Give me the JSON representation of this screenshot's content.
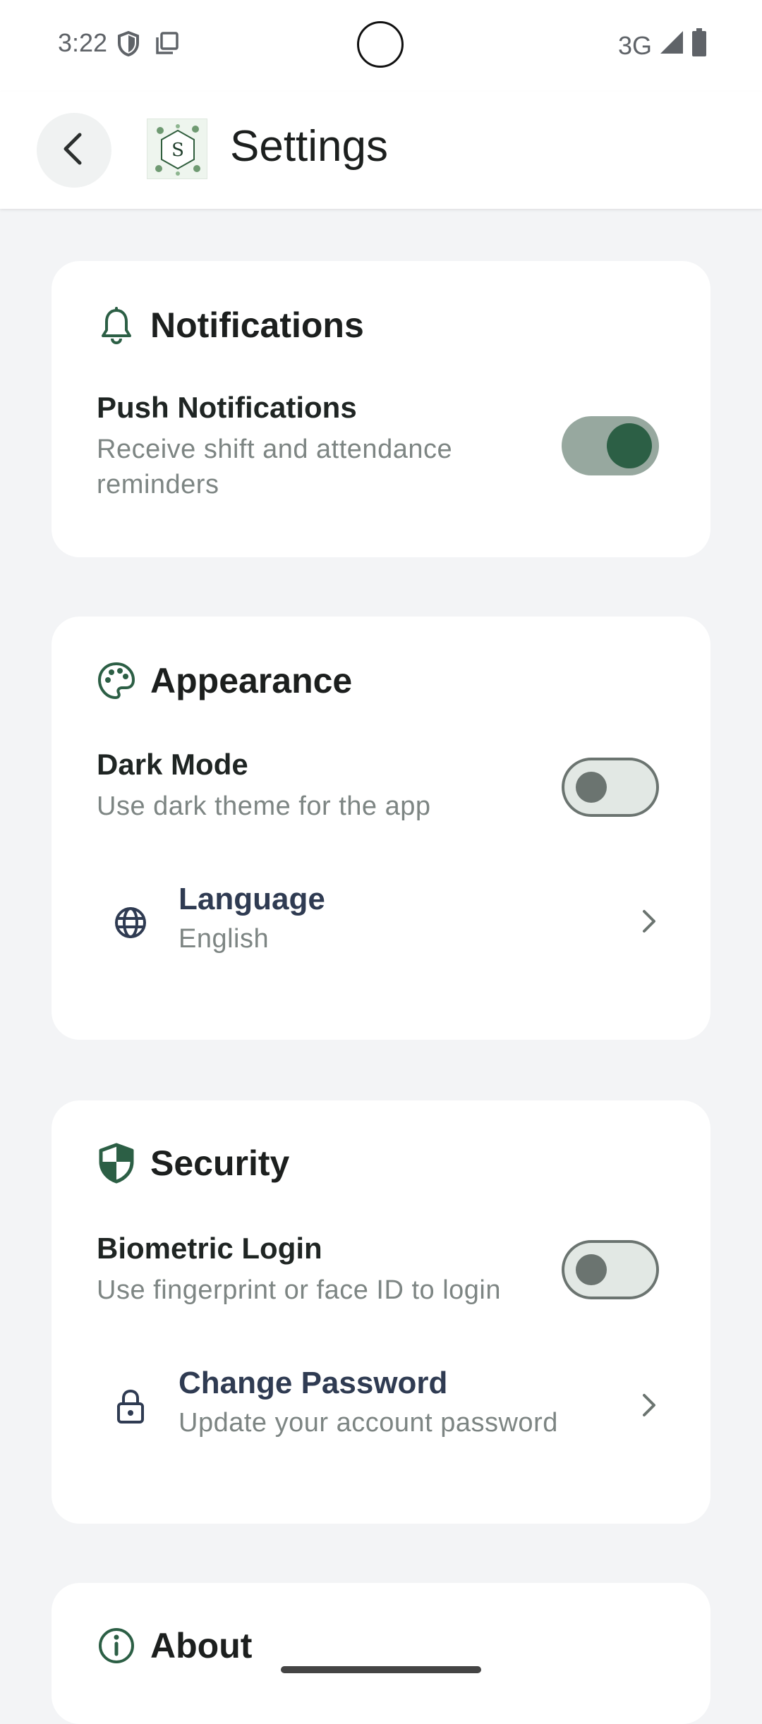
{
  "status_bar": {
    "time": "3:22",
    "network": "3G"
  },
  "app_bar": {
    "title": "Settings",
    "logo_letter": "S"
  },
  "notifications": {
    "title": "Notifications",
    "push": {
      "title": "Push Notifications",
      "subtitle_line1": "Receive shift and attendance",
      "subtitle_line2": "reminders",
      "enabled": true
    }
  },
  "appearance": {
    "title": "Appearance",
    "dark_mode": {
      "title": "Dark Mode",
      "subtitle": "Use dark theme for the app",
      "enabled": false
    },
    "language": {
      "title": "Language",
      "value": "English"
    }
  },
  "security": {
    "title": "Security",
    "biometric": {
      "title": "Biometric Login",
      "subtitle": "Use fingerprint or face ID to login",
      "enabled": false
    },
    "change_password": {
      "title": "Change Password",
      "subtitle": "Update your account password"
    }
  },
  "about": {
    "title": "About"
  },
  "colors": {
    "accent": "#2c5f45",
    "toggle_track_on": "#97a89f",
    "link_title": "#2f3b52"
  }
}
